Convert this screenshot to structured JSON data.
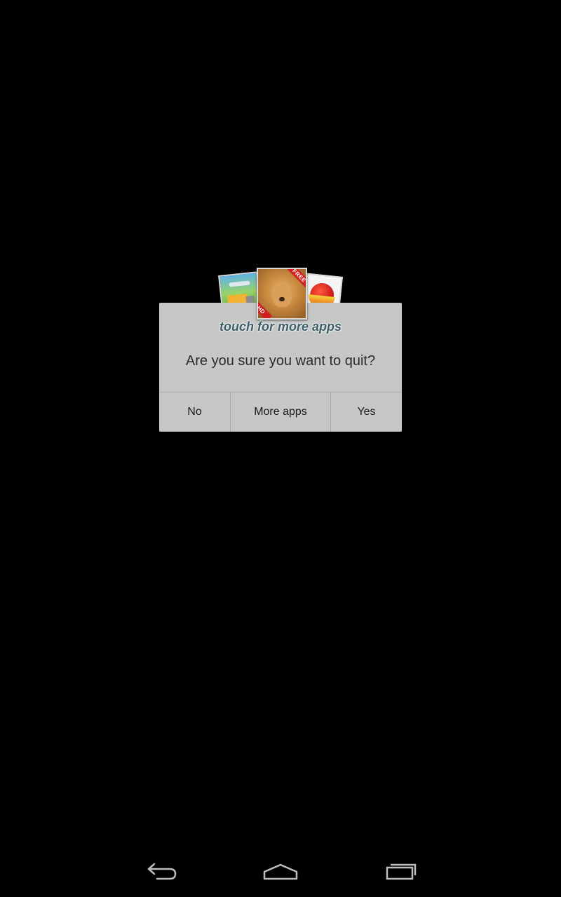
{
  "promo": {
    "text": "touch for more apps",
    "badge_free": "FREE",
    "badge_hd": "HD"
  },
  "dialog": {
    "message": "Are you sure you want to quit?",
    "buttons": {
      "no": "No",
      "more_apps": "More apps",
      "yes": "Yes"
    },
    "background_color": "#c7c7c7"
  },
  "navbar": {
    "icons": [
      "back-icon",
      "home-icon",
      "recents-icon"
    ]
  }
}
